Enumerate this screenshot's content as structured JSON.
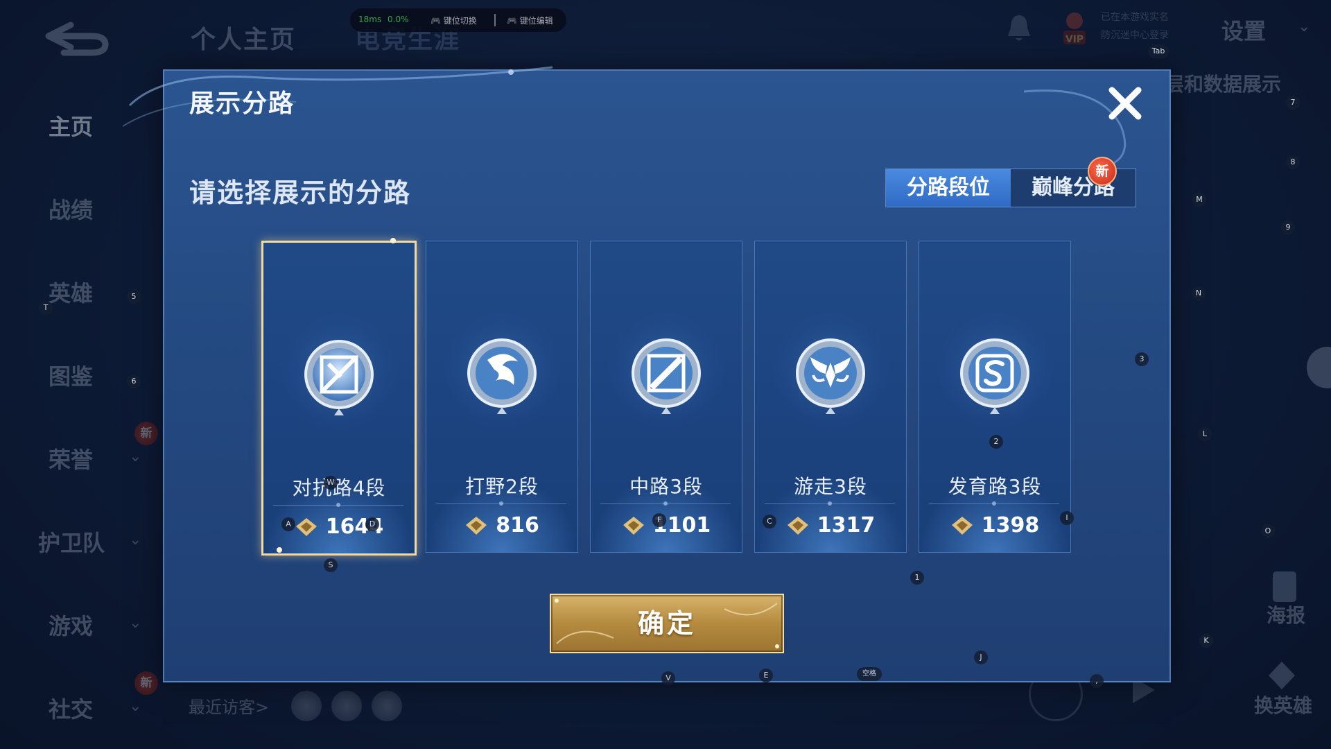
{
  "status_bar": {
    "ping": "18ms",
    "loss": "0.0%",
    "switch_label": "键位切换",
    "edit_label": "键位编辑"
  },
  "header": {
    "tabs": [
      "个人主页",
      "电竞生涯"
    ],
    "settings_label": "设置",
    "vip_label": "VIP",
    "vip_line1": "已在本游戏实名",
    "vip_line2": "防沉迷中心登录",
    "right_peek_text": "层和数据展示"
  },
  "sidebar": {
    "items": [
      {
        "label": "主页"
      },
      {
        "label": "战绩"
      },
      {
        "label": "英雄"
      },
      {
        "label": "图鉴"
      },
      {
        "label": "荣誉"
      },
      {
        "label": "护卫队"
      },
      {
        "label": "游戏"
      },
      {
        "label": "社交"
      }
    ],
    "new_badge": "新"
  },
  "footer": {
    "recent_visitors": "最近访客>",
    "poster_label": "海报",
    "change_hero_label": "换英雄"
  },
  "modal": {
    "title": "展示分路",
    "subtitle": "请选择展示的分路",
    "tabs": [
      {
        "label": "分路段位",
        "active": true
      },
      {
        "label": "巅峰分路",
        "active": false
      }
    ],
    "tab_new_badge": "新",
    "cards": [
      {
        "rank": "对抗路4段",
        "score": "1644",
        "icon": "clash-lane-emblem-icon",
        "selected": true
      },
      {
        "rank": "打野2段",
        "score": "816",
        "icon": "jungle-dragon-emblem-icon",
        "selected": false
      },
      {
        "rank": "中路3段",
        "score": "1101",
        "icon": "mid-lane-emblem-icon",
        "selected": false
      },
      {
        "rank": "游走3段",
        "score": "1317",
        "icon": "roam-wings-emblem-icon",
        "selected": false
      },
      {
        "rank": "发育路3段",
        "score": "1398",
        "icon": "farm-lane-emblem-icon",
        "selected": false
      }
    ],
    "confirm_label": "确定"
  },
  "key_hints": {
    "tab": "Tab",
    "k7": "7",
    "k8": "8",
    "kM": "M",
    "k9": "9",
    "kN": "N",
    "k3": "3",
    "kL": "L",
    "kO": "O",
    "kK": "K",
    "k5": "5",
    "kT": "T",
    "k6": "6",
    "k2": "2",
    "kI": "I",
    "kA": "A",
    "kD": "D",
    "kW": "W",
    "kF": "F",
    "kC": "C",
    "kS": "S",
    "k1": "1",
    "kJ": "J",
    "kV": "V",
    "kE": "E",
    "space": "空格",
    "comma": ","
  },
  "colors": {
    "accent_blue": "#3b7ad6",
    "gold": "#c9a25a",
    "selected_border": "#f1d9a6",
    "new_badge": "#d6452e"
  }
}
